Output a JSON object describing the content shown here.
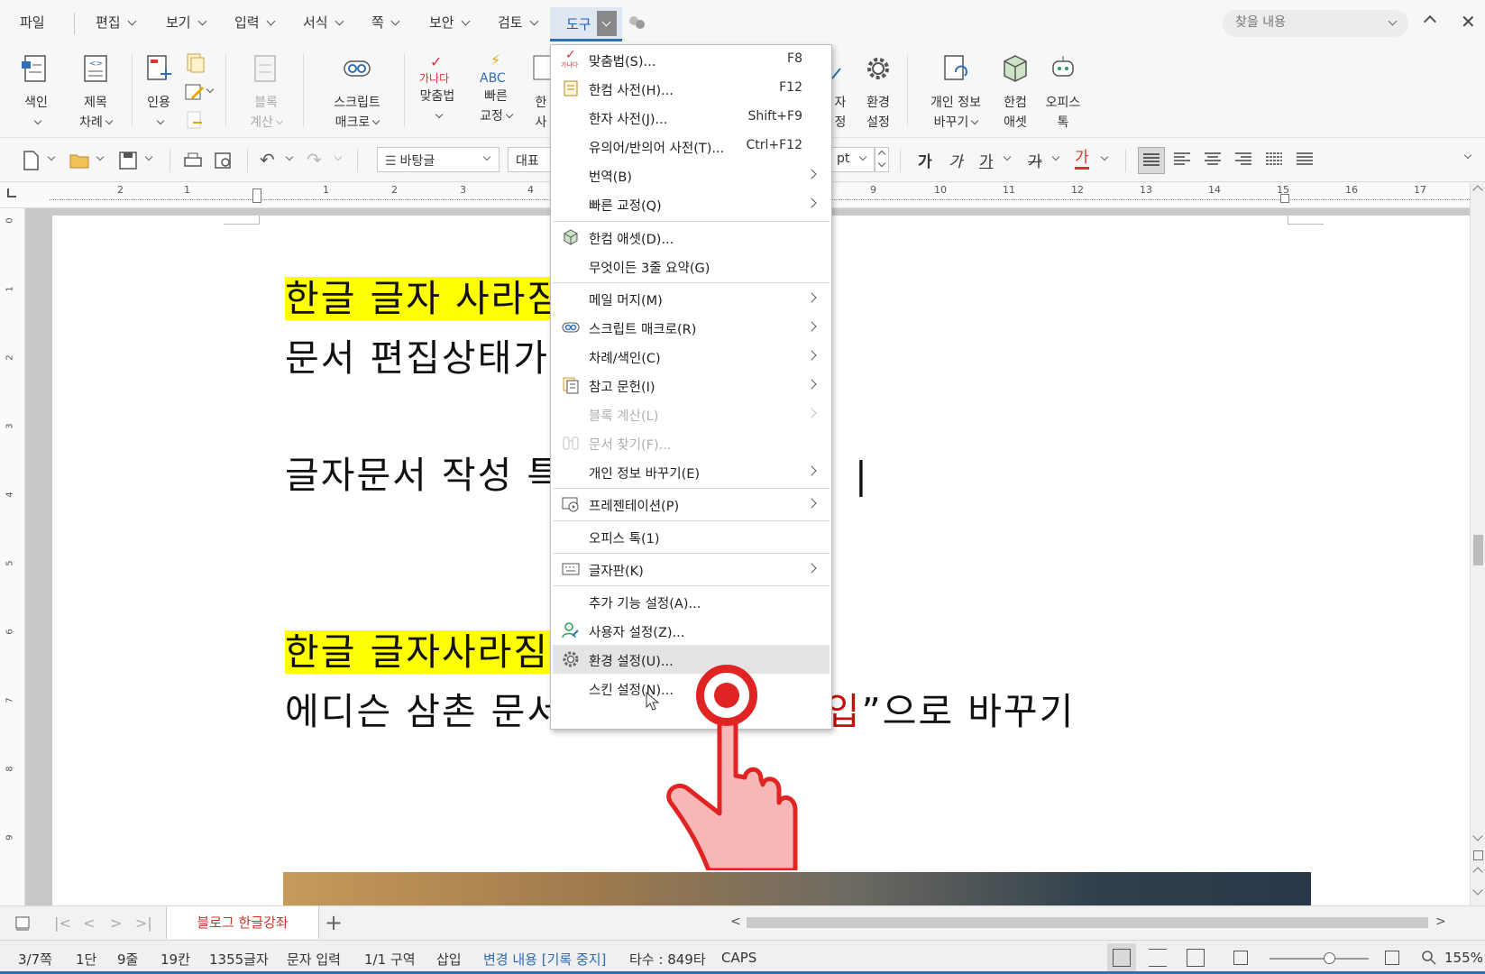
{
  "menubar": {
    "items": [
      "파일",
      "편집",
      "보기",
      "입력",
      "서식",
      "쪽",
      "보안",
      "검토",
      "도구"
    ],
    "active": "도구",
    "search_placeholder": "찾을 내용"
  },
  "ribbon": {
    "index": "색인",
    "toc_1": "제목",
    "toc_2": "차례",
    "citation": "인용",
    "block_calc_1": "블록",
    "block_calc_2": "계산",
    "script_1": "스크립트",
    "script_2": "매크로",
    "spell_icon_text": "가나다",
    "spell": "맞춤법",
    "quick_fix_icon_text": "ABC",
    "quick_fix_1": "빠른",
    "quick_fix_2": "교정",
    "hanja_1": "한",
    "hanja_2": "사",
    "partial_1": "자",
    "partial_2": "정",
    "env_1": "환경",
    "env_2": "설정",
    "privacy_1": "개인 정보",
    "privacy_2": "바꾸기",
    "asset_1": "한컴",
    "asset_2": "애셋",
    "office_1": "오피스",
    "office_2": "톡"
  },
  "toolbar": {
    "style_select": "바탕글",
    "font_select": "대표",
    "size_unit": "pt",
    "fmt_bold": "가",
    "fmt_italic": "가",
    "fmt_underline": "가",
    "fmt_strike": "가",
    "fmt_color": "가"
  },
  "ruler": {
    "h_numbers": [
      "2",
      "1",
      "1",
      "2",
      "3",
      "4",
      "9",
      "10",
      "11",
      "12",
      "13",
      "14",
      "15",
      "16",
      "17"
    ],
    "v_numbers": [
      "0",
      "1",
      "2",
      "3",
      "4",
      "5",
      "6",
      "7",
      "8",
      "9"
    ]
  },
  "document": {
    "line1_highlight": "한글 글자 사라짐",
    "line2": "문서 편집상태가",
    "line3": "글자문서 작성 특",
    "line3_tail": "|",
    "line4_highlight": "한글 글자사라짐의",
    "line5_prefix": "에디슨 삼촌 문서 편집상태를",
    "line5_red": "삽입",
    "line5_suffix": "”으로 바꾸기"
  },
  "tools_menu": {
    "items": [
      {
        "label": "맞춤법(S)...",
        "shortcut": "F8",
        "icon": "spellcheck-icon"
      },
      {
        "label": "한컴 사전(H)...",
        "shortcut": "F12",
        "icon": "dictionary-icon"
      },
      {
        "label": "한자 사전(J)...",
        "shortcut": "Shift+F9"
      },
      {
        "label": "유의어/반의어 사전(T)...",
        "shortcut": "Ctrl+F12"
      },
      {
        "label": "번역(B)",
        "submenu": true
      },
      {
        "label": "빠른 교정(Q)",
        "submenu": true
      },
      {
        "label": "한컴 애셋(D)...",
        "icon": "asset-cube-icon"
      },
      {
        "label": "무엇이든 3줄 요약(G)"
      },
      {
        "label": "메일 머지(M)",
        "submenu": true
      },
      {
        "label": "스크립트 매크로(R)",
        "submenu": true,
        "icon": "macro-icon"
      },
      {
        "label": "차례/색인(C)",
        "submenu": true
      },
      {
        "label": "참고 문헌(I)",
        "submenu": true,
        "icon": "reference-icon"
      },
      {
        "label": "블록 계산(L)",
        "submenu": true,
        "disabled": true
      },
      {
        "label": "문서 찾기(F)...",
        "disabled": true,
        "icon": "binoculars-icon"
      },
      {
        "label": "개인 정보 바꾸기(E)",
        "submenu": true
      },
      {
        "label": "프레젠테이션(P)",
        "submenu": true,
        "icon": "presentation-icon"
      },
      {
        "label": "오피스 톡(1)"
      },
      {
        "label": "글자판(K)",
        "submenu": true,
        "icon": "keyboard-icon"
      },
      {
        "label": "추가 기능 설정(A)..."
      },
      {
        "label": "사용자 설정(Z)...",
        "icon": "user-settings-icon"
      },
      {
        "label": "환경 설정(U)...",
        "icon": "gear-icon",
        "hover": true
      },
      {
        "label": "스킨 설정(N)..."
      }
    ]
  },
  "tabs": {
    "sheet": "블로그 한글강좌"
  },
  "statusbar": {
    "page": "3/7쪽",
    "column": "1단",
    "line": "9줄",
    "col": "19칸",
    "chars": "1355글자",
    "mode": "문자 입력",
    "section": "1/1 구역",
    "insert": "삽입",
    "track": "변경 내용 [기록 중지]",
    "typing": "타수 : 849타",
    "caps": "CAPS",
    "zoom": "155%"
  },
  "colors": {
    "accent": "#2f6fb5",
    "highlight": "#ffff00",
    "red_text": "#c80d0d",
    "click_marker": "#e02424"
  }
}
